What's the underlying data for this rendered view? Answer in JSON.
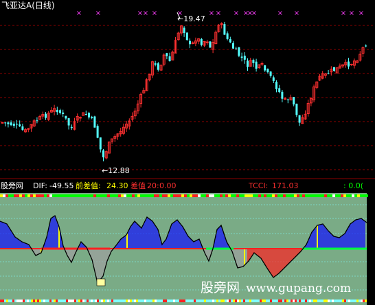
{
  "title_bar": {
    "stock_name": "飞亚达A",
    "period": "(日线)",
    "name_color": "#ffffff"
  },
  "price_panel": {
    "high_label": "19.47",
    "low_label": "12.88",
    "up_color": "#ff3030",
    "down_color": "#54ffff",
    "grid_color": "#8b0000",
    "marker_color": "#ff40ff",
    "marker_glyph": "×"
  },
  "indicator_bar": {
    "brand": "股旁网",
    "dif_label": "DIF:",
    "dif_value": "-49.55",
    "prev_diff_label": "前差值:",
    "prev_diff_value": "24.30",
    "diff_label": "差值",
    "diff_param": "20:",
    "diff_value": "0.00",
    "tcci_label": "TCCI:",
    "tcci_value": "171.03",
    "tail_value": ": 0.0(",
    "dif_color": "#ffffff",
    "prev_color": "#ffff00",
    "diff_color": "#ff3030",
    "tcci_color": "#ff3030",
    "tail_color": "#00ff00"
  },
  "indicator_panel": {
    "background": "#7aab86",
    "positive_color": "#1010ff",
    "negative_color": "#ff2020",
    "neutral_color": "#a0a0a0",
    "zero_line_color": "#ff2020",
    "signal_line_color": "#00ff40"
  },
  "watermark": {
    "text_cn": "股旁网",
    "text_url": "www.gupang.com",
    "color": "#ffffff"
  }
}
